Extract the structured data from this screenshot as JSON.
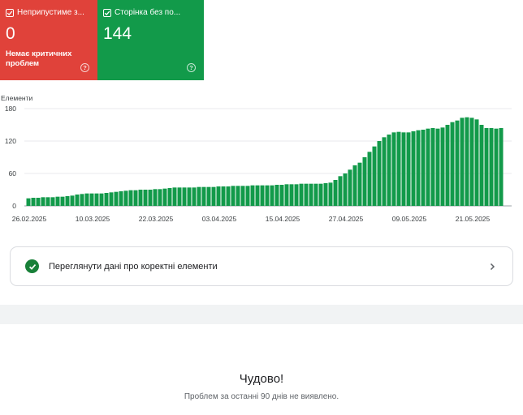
{
  "cards": [
    {
      "label": "Неприпустиме з...",
      "value": "0",
      "subtitle": "Немає критичних проблем",
      "color": "#e0423a"
    },
    {
      "label": "Сторінка без по...",
      "value": "144",
      "subtitle": "",
      "color": "#129a4a"
    }
  ],
  "icons": {
    "card_check": "checkbox-checked-icon",
    "card_help": "help-circle-icon",
    "ok": "check-circle-icon",
    "chevron": "chevron-right-icon"
  },
  "chart_data": {
    "type": "bar",
    "ylabel": "Елементи",
    "ylim": [
      0,
      180
    ],
    "yticks": [
      0,
      60,
      120,
      180
    ],
    "grid": true,
    "bar_color": "#129a4a",
    "xtick_labels": [
      "26.02.2025",
      "10.03.2025",
      "22.03.2025",
      "03.04.2025",
      "15.04.2025",
      "27.04.2025",
      "09.05.2025",
      "21.05.2025"
    ],
    "x_start": "25.02.2025",
    "x_end": "27.05.2025",
    "values": [
      14,
      15,
      15,
      16,
      16,
      16,
      17,
      17,
      18,
      19,
      21,
      22,
      23,
      23,
      23,
      23,
      24,
      25,
      26,
      27,
      28,
      29,
      29,
      30,
      30,
      30,
      31,
      31,
      32,
      33,
      34,
      34,
      34,
      34,
      34,
      35,
      35,
      35,
      35,
      36,
      36,
      36,
      37,
      37,
      37,
      37,
      38,
      38,
      38,
      38,
      38,
      39,
      39,
      40,
      40,
      40,
      41,
      41,
      41,
      41,
      41,
      42,
      43,
      48,
      55,
      60,
      67,
      75,
      80,
      90,
      100,
      110,
      120,
      127,
      132,
      136,
      137,
      136,
      136,
      138,
      140,
      141,
      143,
      144,
      143,
      145,
      150,
      155,
      158,
      163,
      164,
      163,
      160,
      150,
      144,
      144,
      143,
      144
    ]
  },
  "link_row": {
    "label": "Переглянути дані про коректні елементи"
  },
  "summary": {
    "title": "Чудово!",
    "message": "Проблем за останні 90 днів не виявлено."
  }
}
